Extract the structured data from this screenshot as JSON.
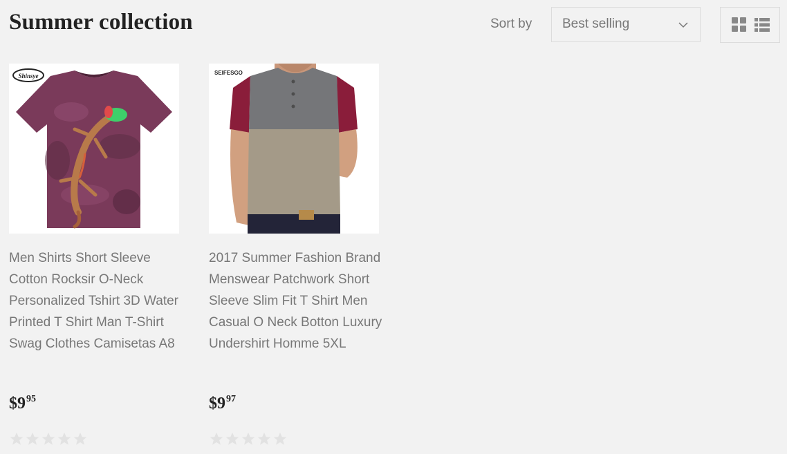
{
  "collection": {
    "title": "Summer collection"
  },
  "toolbar": {
    "sort_label": "Sort by",
    "sort_value": "Best selling",
    "view_modes": [
      "grid-view-icon",
      "list-view-icon"
    ]
  },
  "products": [
    {
      "title": "Men Shirts Short Sleeve Cotton Rocksir O-Neck Personalized Tshirt 3D Water Printed T Shirt Man T-Shirt Swag Clothes Camisetas A8",
      "brand_logo": "Shinsye",
      "price_main": "$9",
      "price_cents": "95",
      "rating": 0,
      "image": "purple-lizard-tshirt"
    },
    {
      "title": "2017 Summer Fashion Brand Menswear Patchwork Short Sleeve Slim Fit T Shirt Men Casual O Neck Botton Luxury Undershirt Homme 5XL",
      "brand_logo": "SEIFESGO",
      "price_main": "$9",
      "price_cents": "97",
      "rating": 0,
      "image": "patchwork-henley-tshirt"
    }
  ],
  "colors": {
    "background": "#f2f2f2",
    "title_text": "#222222",
    "muted_text": "#777777",
    "border": "#dcdcdc",
    "star_empty": "#e2e2e2",
    "icon": "#888888"
  }
}
